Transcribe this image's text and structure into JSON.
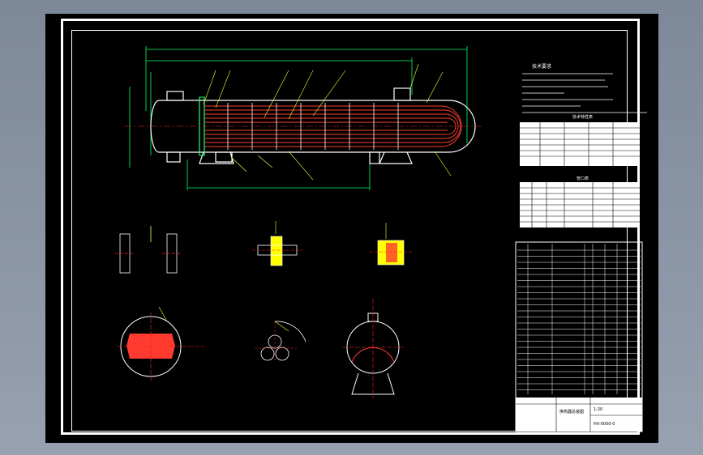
{
  "document": {
    "title": "",
    "notes_header": "技术要求",
    "table1_title": "技术特性表",
    "table2_title": "管口表",
    "drawing_no": "HX-0000-0",
    "part_name": "换热器总装图",
    "scale": "1:20"
  },
  "colors": {
    "background": "#000000",
    "frame": "#ffffff",
    "vessel": "#ffffff",
    "tube_bundle": "#ff3b2f",
    "dimension": "#00ff66",
    "leader": "#ffff40",
    "center_line": "#ff2020",
    "detail": "#ffff00"
  }
}
